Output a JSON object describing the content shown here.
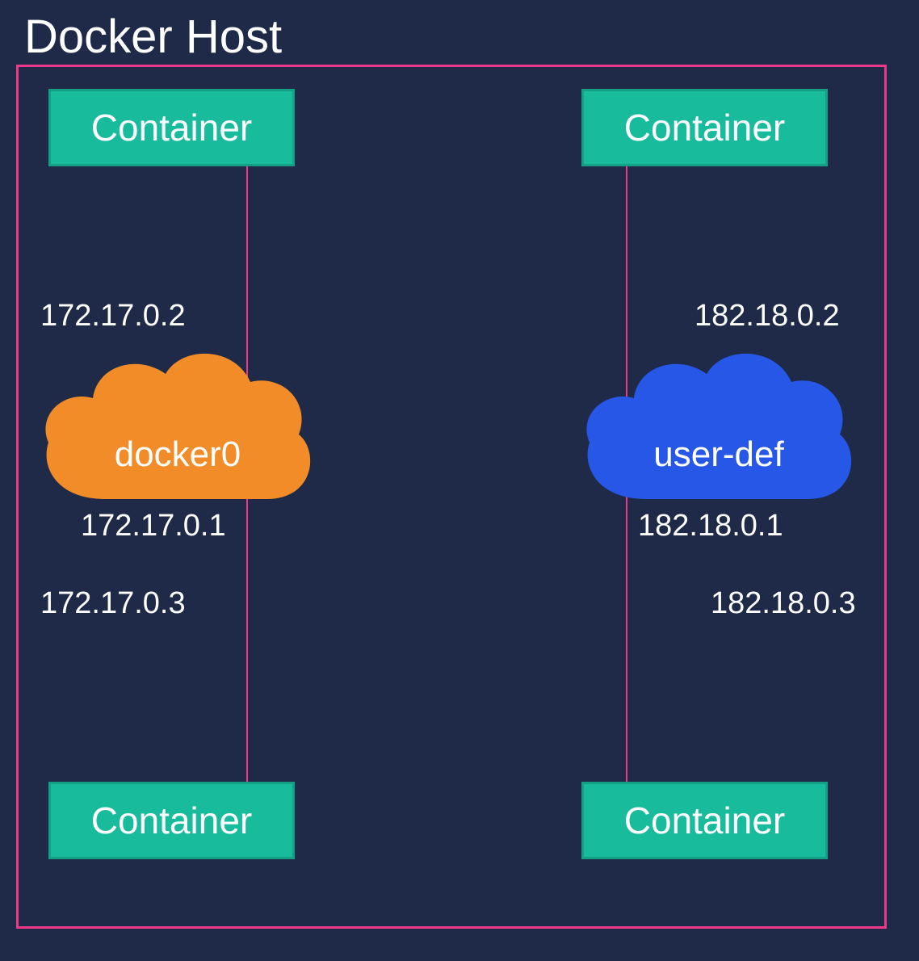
{
  "title": "Docker Host",
  "left": {
    "container_label": "Container",
    "network_name": "docker0",
    "gateway_ip": "172.17.0.1",
    "container_top_ip": "172.17.0.2",
    "container_bottom_ip": "172.17.0.3",
    "cloud_color": "#f28c28"
  },
  "right": {
    "container_label": "Container",
    "network_name": "user-def",
    "gateway_ip": "182.18.0.1",
    "container_top_ip": "182.18.0.2",
    "container_bottom_ip": "182.18.0.3",
    "cloud_color": "#2757e6"
  },
  "colors": {
    "background": "#1e2a47",
    "border": "#ec3a88",
    "container": "#18bc9c"
  }
}
